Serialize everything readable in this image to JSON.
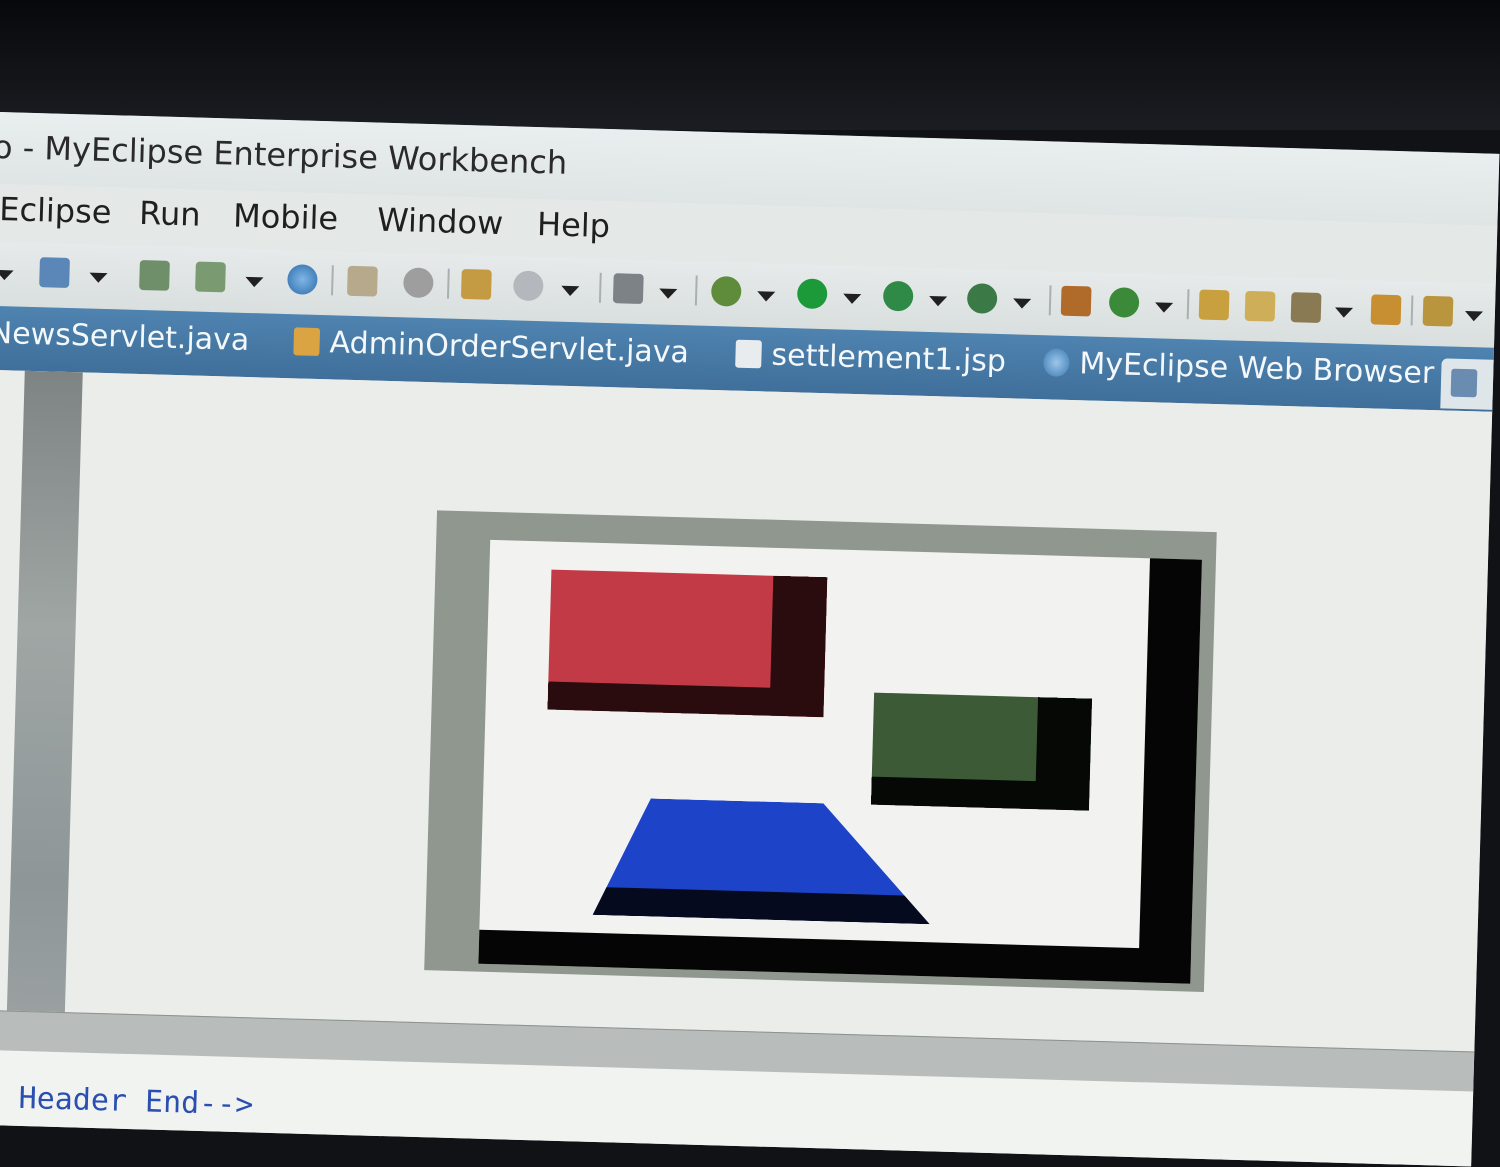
{
  "window": {
    "title": "o - MyEclipse Enterprise Workbench"
  },
  "menu": [
    "Eclipse",
    "Run",
    "Mobile",
    "Window",
    "Help"
  ],
  "toolbar": {
    "icons": [
      "new-wizard-icon",
      "deploy-icon",
      "server-icon",
      "globe-icon",
      "package-icon",
      "refresh-icon",
      "report-icon",
      "web-service-icon",
      "camera-icon",
      "debug-icon",
      "run-icon",
      "run-config-icon",
      "run-external-icon",
      "grid-icon",
      "refresh-g-icon",
      "open-folder-icon",
      "folder-icon",
      "pen-icon",
      "folder-open-icon",
      "download-icon"
    ]
  },
  "tabs": [
    {
      "label": "NewsServlet.java",
      "icon": "java-file-icon"
    },
    {
      "label": "AdminOrderServlet.java",
      "icon": "java-file-icon"
    },
    {
      "label": "settlement1.jsp",
      "icon": "jsp-file-icon"
    },
    {
      "label": "MyEclipse Web Browser",
      "icon": "globe-icon"
    }
  ],
  "code": {
    "line": "nd Header End-->"
  },
  "colors": {
    "accent": "#4f83b0",
    "preview_red": "#c23a46",
    "preview_green": "#3d5a37",
    "preview_blue": "#1d44c8"
  }
}
